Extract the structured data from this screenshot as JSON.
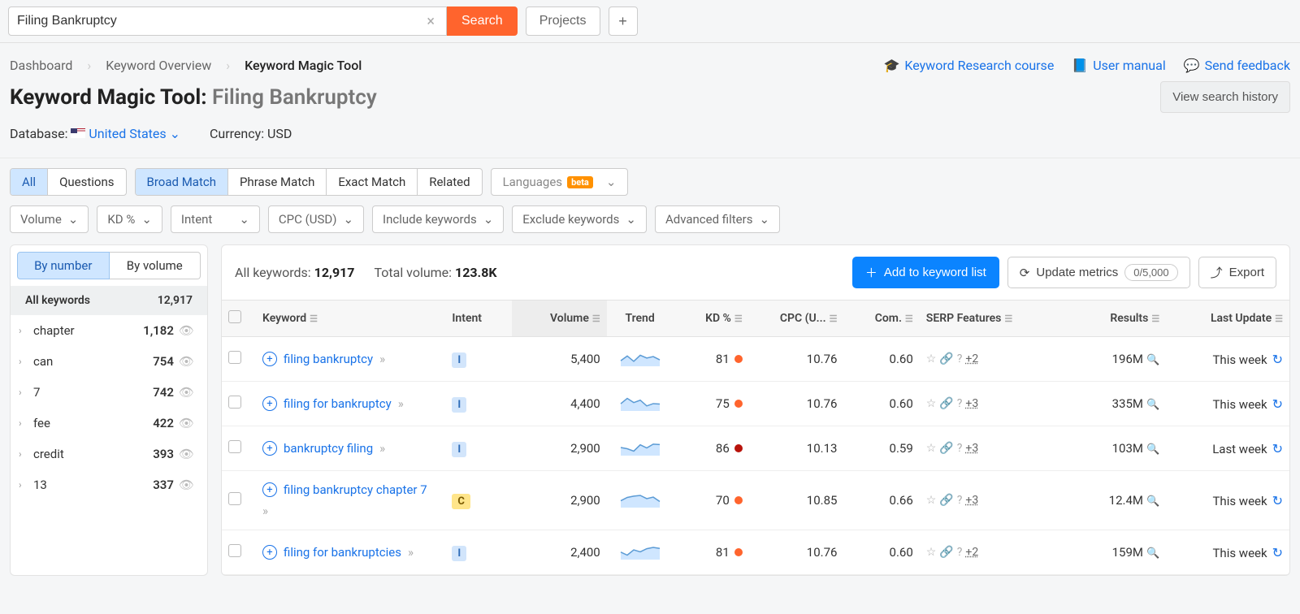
{
  "search": {
    "value": "Filing Bankruptcy",
    "button": "Search",
    "projects": "Projects"
  },
  "breadcrumbs": {
    "dashboard": "Dashboard",
    "overview": "Keyword Overview",
    "tool": "Keyword Magic Tool"
  },
  "headerLinks": {
    "course": "Keyword Research course",
    "manual": "User manual",
    "feedback": "Send feedback"
  },
  "title": {
    "main": "Keyword Magic Tool:",
    "query": "Filing Bankruptcy",
    "history": "View search history"
  },
  "meta": {
    "databaseLabel": "Database:",
    "database": "United States",
    "currency": "Currency: USD"
  },
  "modeTabs": {
    "all": "All",
    "questions": "Questions",
    "broad": "Broad Match",
    "phrase": "Phrase Match",
    "exact": "Exact Match",
    "related": "Related",
    "languages": "Languages",
    "beta": "beta"
  },
  "filters": {
    "volume": "Volume",
    "kd": "KD %",
    "intent": "Intent",
    "cpc": "CPC (USD)",
    "include": "Include keywords",
    "exclude": "Exclude keywords",
    "advanced": "Advanced filters"
  },
  "sidebar": {
    "byNumber": "By number",
    "byVolume": "By volume",
    "allLabel": "All keywords",
    "allCount": "12,917",
    "items": [
      {
        "name": "chapter",
        "count": "1,182"
      },
      {
        "name": "can",
        "count": "754"
      },
      {
        "name": "7",
        "count": "742"
      },
      {
        "name": "fee",
        "count": "422"
      },
      {
        "name": "credit",
        "count": "393"
      },
      {
        "name": "13",
        "count": "337"
      }
    ]
  },
  "summary": {
    "allLabel": "All keywords:",
    "allValue": "12,917",
    "totalLabel": "Total volume:",
    "totalValue": "123.8K",
    "addBtn": "Add to keyword list",
    "updateBtn": "Update metrics",
    "updateCount": "0/5,000",
    "exportBtn": "Export"
  },
  "columns": {
    "keyword": "Keyword",
    "intent": "Intent",
    "volume": "Volume",
    "trend": "Trend",
    "kd": "KD %",
    "cpc": "CPC (U...",
    "com": "Com.",
    "serp": "SERP Features",
    "results": "Results",
    "last": "Last Update"
  },
  "rows": [
    {
      "keyword": "filing bankruptcy",
      "intent": "I",
      "volume": "5,400",
      "kd": "81",
      "kdClass": "",
      "cpc": "10.76",
      "com": "0.60",
      "serpMore": "+2",
      "results": "196M",
      "last": "This week"
    },
    {
      "keyword": "filing for bankruptcy",
      "intent": "I",
      "volume": "4,400",
      "kd": "75",
      "kdClass": "",
      "cpc": "10.76",
      "com": "0.60",
      "serpMore": "+3",
      "results": "335M",
      "last": "This week"
    },
    {
      "keyword": "bankruptcy filing",
      "intent": "I",
      "volume": "2,900",
      "kd": "86",
      "kdClass": "dark",
      "cpc": "10.13",
      "com": "0.59",
      "serpMore": "+3",
      "results": "103M",
      "last": "Last week"
    },
    {
      "keyword": "filing bankruptcy chapter 7",
      "intent": "C",
      "volume": "2,900",
      "kd": "70",
      "kdClass": "",
      "cpc": "10.85",
      "com": "0.66",
      "serpMore": "+3",
      "results": "12.4M",
      "last": "This week"
    },
    {
      "keyword": "filing for bankruptcies",
      "intent": "I",
      "volume": "2,400",
      "kd": "81",
      "kdClass": "",
      "cpc": "10.76",
      "com": "0.60",
      "serpMore": "+2",
      "results": "159M",
      "last": "This week"
    }
  ]
}
